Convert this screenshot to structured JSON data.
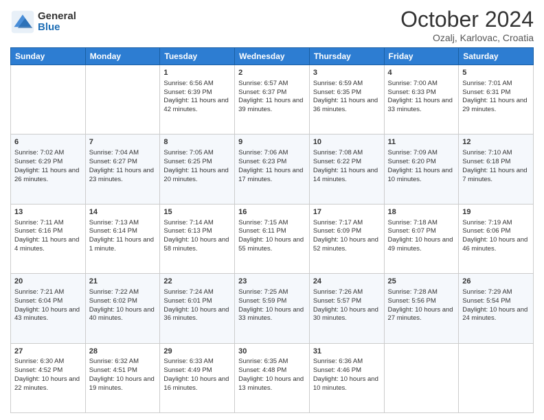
{
  "header": {
    "logo_general": "General",
    "logo_blue": "Blue",
    "title": "October 2024",
    "subtitle": "Ozalj, Karlovac, Croatia"
  },
  "columns": [
    "Sunday",
    "Monday",
    "Tuesday",
    "Wednesday",
    "Thursday",
    "Friday",
    "Saturday"
  ],
  "weeks": [
    [
      {
        "day": "",
        "info": ""
      },
      {
        "day": "",
        "info": ""
      },
      {
        "day": "1",
        "info": "Sunrise: 6:56 AM\nSunset: 6:39 PM\nDaylight: 11 hours and 42 minutes."
      },
      {
        "day": "2",
        "info": "Sunrise: 6:57 AM\nSunset: 6:37 PM\nDaylight: 11 hours and 39 minutes."
      },
      {
        "day": "3",
        "info": "Sunrise: 6:59 AM\nSunset: 6:35 PM\nDaylight: 11 hours and 36 minutes."
      },
      {
        "day": "4",
        "info": "Sunrise: 7:00 AM\nSunset: 6:33 PM\nDaylight: 11 hours and 33 minutes."
      },
      {
        "day": "5",
        "info": "Sunrise: 7:01 AM\nSunset: 6:31 PM\nDaylight: 11 hours and 29 minutes."
      }
    ],
    [
      {
        "day": "6",
        "info": "Sunrise: 7:02 AM\nSunset: 6:29 PM\nDaylight: 11 hours and 26 minutes."
      },
      {
        "day": "7",
        "info": "Sunrise: 7:04 AM\nSunset: 6:27 PM\nDaylight: 11 hours and 23 minutes."
      },
      {
        "day": "8",
        "info": "Sunrise: 7:05 AM\nSunset: 6:25 PM\nDaylight: 11 hours and 20 minutes."
      },
      {
        "day": "9",
        "info": "Sunrise: 7:06 AM\nSunset: 6:23 PM\nDaylight: 11 hours and 17 minutes."
      },
      {
        "day": "10",
        "info": "Sunrise: 7:08 AM\nSunset: 6:22 PM\nDaylight: 11 hours and 14 minutes."
      },
      {
        "day": "11",
        "info": "Sunrise: 7:09 AM\nSunset: 6:20 PM\nDaylight: 11 hours and 10 minutes."
      },
      {
        "day": "12",
        "info": "Sunrise: 7:10 AM\nSunset: 6:18 PM\nDaylight: 11 hours and 7 minutes."
      }
    ],
    [
      {
        "day": "13",
        "info": "Sunrise: 7:11 AM\nSunset: 6:16 PM\nDaylight: 11 hours and 4 minutes."
      },
      {
        "day": "14",
        "info": "Sunrise: 7:13 AM\nSunset: 6:14 PM\nDaylight: 11 hours and 1 minute."
      },
      {
        "day": "15",
        "info": "Sunrise: 7:14 AM\nSunset: 6:13 PM\nDaylight: 10 hours and 58 minutes."
      },
      {
        "day": "16",
        "info": "Sunrise: 7:15 AM\nSunset: 6:11 PM\nDaylight: 10 hours and 55 minutes."
      },
      {
        "day": "17",
        "info": "Sunrise: 7:17 AM\nSunset: 6:09 PM\nDaylight: 10 hours and 52 minutes."
      },
      {
        "day": "18",
        "info": "Sunrise: 7:18 AM\nSunset: 6:07 PM\nDaylight: 10 hours and 49 minutes."
      },
      {
        "day": "19",
        "info": "Sunrise: 7:19 AM\nSunset: 6:06 PM\nDaylight: 10 hours and 46 minutes."
      }
    ],
    [
      {
        "day": "20",
        "info": "Sunrise: 7:21 AM\nSunset: 6:04 PM\nDaylight: 10 hours and 43 minutes."
      },
      {
        "day": "21",
        "info": "Sunrise: 7:22 AM\nSunset: 6:02 PM\nDaylight: 10 hours and 40 minutes."
      },
      {
        "day": "22",
        "info": "Sunrise: 7:24 AM\nSunset: 6:01 PM\nDaylight: 10 hours and 36 minutes."
      },
      {
        "day": "23",
        "info": "Sunrise: 7:25 AM\nSunset: 5:59 PM\nDaylight: 10 hours and 33 minutes."
      },
      {
        "day": "24",
        "info": "Sunrise: 7:26 AM\nSunset: 5:57 PM\nDaylight: 10 hours and 30 minutes."
      },
      {
        "day": "25",
        "info": "Sunrise: 7:28 AM\nSunset: 5:56 PM\nDaylight: 10 hours and 27 minutes."
      },
      {
        "day": "26",
        "info": "Sunrise: 7:29 AM\nSunset: 5:54 PM\nDaylight: 10 hours and 24 minutes."
      }
    ],
    [
      {
        "day": "27",
        "info": "Sunrise: 6:30 AM\nSunset: 4:52 PM\nDaylight: 10 hours and 22 minutes."
      },
      {
        "day": "28",
        "info": "Sunrise: 6:32 AM\nSunset: 4:51 PM\nDaylight: 10 hours and 19 minutes."
      },
      {
        "day": "29",
        "info": "Sunrise: 6:33 AM\nSunset: 4:49 PM\nDaylight: 10 hours and 16 minutes."
      },
      {
        "day": "30",
        "info": "Sunrise: 6:35 AM\nSunset: 4:48 PM\nDaylight: 10 hours and 13 minutes."
      },
      {
        "day": "31",
        "info": "Sunrise: 6:36 AM\nSunset: 4:46 PM\nDaylight: 10 hours and 10 minutes."
      },
      {
        "day": "",
        "info": ""
      },
      {
        "day": "",
        "info": ""
      }
    ]
  ]
}
